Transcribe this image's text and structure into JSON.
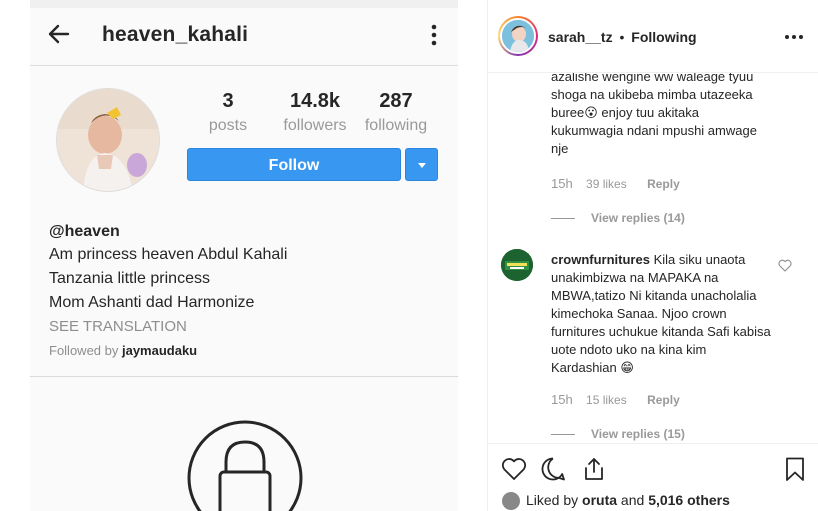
{
  "profile_screenshot": {
    "username": "heaven_kahali",
    "stats": [
      {
        "value": "3",
        "label": "posts"
      },
      {
        "value": "14.8k",
        "label": "followers"
      },
      {
        "value": "287",
        "label": "following"
      }
    ],
    "follow_label": "Follow",
    "bio": {
      "handle": "@heaven",
      "lines": [
        "Am princess heaven Abdul Kahali",
        "Tanzania little princess",
        "Mom Ashanti dad Harmonize"
      ],
      "see_translation": "SEE TRANSLATION",
      "followed_by_prefix": "Followed by ",
      "followed_by_user": "jaymaudaku"
    }
  },
  "post_panel": {
    "author": "sarah__tz",
    "separator": "•",
    "follow_state": "Following",
    "comments": [
      {
        "text": "azalishe wengine ww waleage tyuu shoga na ukibeba mimba utazeeka buree😮 enjoy tuu akitaka kukumwagia ndani mpushi amwage nje",
        "time": "15h",
        "likes": "39 likes",
        "reply": "Reply",
        "view_replies": "View replies (14)"
      },
      {
        "author": "crownfurnitures",
        "text": "Kila siku unaota unakimbizwa na MAPAKA na MBWA,tatizo Ni kitanda unacholalia kimechoka Sanaa. Njoo crown furnitures uchukue kitanda Safi kabisa uote ndoto uko na kina kim Kardashian 😁",
        "time": "15h",
        "likes": "15 likes",
        "reply": "Reply",
        "view_replies": "View replies (15)"
      }
    ],
    "liked_by_prefix": "Liked by ",
    "liked_by_user": "oruta",
    "liked_by_mid": " and ",
    "liked_by_others": "5,016 others"
  },
  "colors": {
    "accent": "#3897f0",
    "text": "#262626",
    "muted": "#8e8e8e"
  }
}
